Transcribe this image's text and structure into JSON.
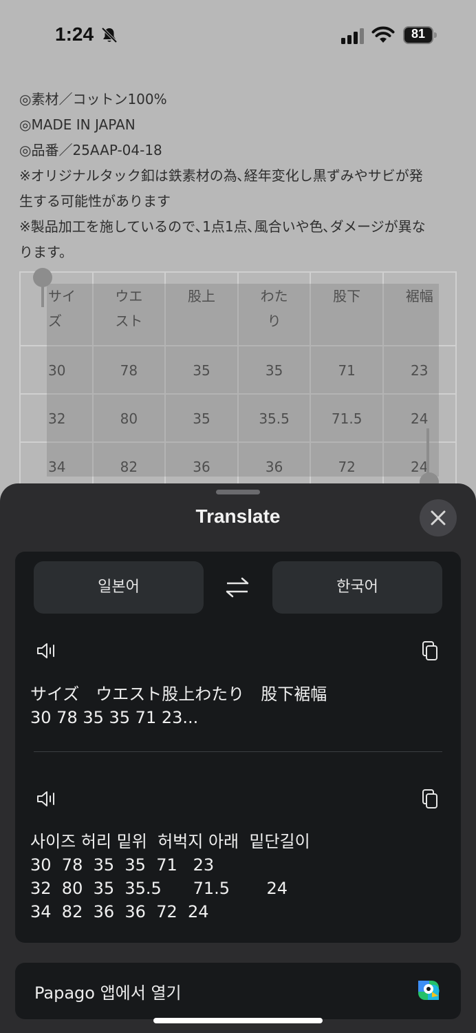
{
  "status_bar": {
    "time": "1:24",
    "battery": "81"
  },
  "product": {
    "lines": [
      "◎素材／コットン100%",
      "◎MADE IN JAPAN",
      "◎品番／25AAP-04-18",
      "※オリジナルタック釦は鉄素材の為､経年変化し黒ずみやサビが発",
      "生する可能性があります",
      "※製品加工を施しているので､1点1点､風合いや色､ダメージが異な",
      "ります。"
    ]
  },
  "size_table": {
    "headers": [
      "サイ\nズ",
      "ウエ\nスト",
      "股上",
      "わた\nり",
      "股下",
      "裾幅"
    ],
    "rows": [
      [
        "30",
        "78",
        "35",
        "35",
        "71",
        "23"
      ],
      [
        "32",
        "80",
        "35",
        "35.5",
        "71.5",
        "24"
      ],
      [
        "34",
        "82",
        "36",
        "36",
        "72",
        "24"
      ]
    ]
  },
  "sheet": {
    "title": "Translate",
    "source_lang": "일본어",
    "target_lang": "한국어",
    "source_text": "サイズ　ウエスト股上わたり　股下裾幅\n30 78 35 35 71 23...",
    "translated_text": "사이즈 허리 밑위  허벅지 아래  밑단길이\n30  78  35  35  71   23\n32  80  35  35.5      71.5       24\n34  82  36  36  72  24",
    "open_in_app": "Papago 앱에서 열기"
  },
  "colors": {
    "sheet_bg": "#2c2c2e",
    "card_bg": "#17191b",
    "dimmed_page": "#b8b8b8"
  },
  "icons": {
    "bell": "bell-slash-icon",
    "signal": "cellular-signal-icon",
    "wifi": "wifi-icon",
    "close": "close-icon",
    "swap": "swap-arrows-icon",
    "speaker": "speaker-icon",
    "copy": "copy-icon",
    "papago": "papago-logo-icon"
  }
}
